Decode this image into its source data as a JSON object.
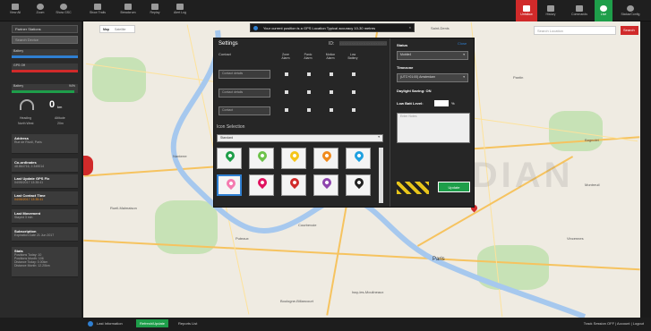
{
  "toolbar": {
    "items": [
      {
        "label": "View All",
        "icon": "layers-icon"
      },
      {
        "label": "Zoom",
        "icon": "globe-icon"
      },
      {
        "label": "Show GSC",
        "icon": "globe-icon"
      },
      {
        "label": "Show Trails",
        "icon": "trail-icon"
      },
      {
        "label": "Breadcrum",
        "icon": "warning-icon"
      },
      {
        "label": "Replay",
        "icon": "plus-icon"
      },
      {
        "label": "Alert Log",
        "icon": "card-icon"
      }
    ],
    "right_items": [
      {
        "label": "Unfollow",
        "icon": "share-icon"
      },
      {
        "label": "History",
        "icon": "image-icon"
      },
      {
        "label": "Commands",
        "icon": "send-icon"
      },
      {
        "label": "Live",
        "icon": "power-icon"
      },
      {
        "label": "Status/Config",
        "icon": "gear-icon"
      }
    ]
  },
  "sidebar": {
    "device_btn": "Partner Stations",
    "search_placeholder": "Search Device",
    "bars": [
      {
        "label": "Battery",
        "color": "#2f7fd1",
        "fraction": 1.0
      },
      {
        "label": "GPS Off",
        "color": "#d02a2a",
        "fraction": 1.0
      },
      {
        "label": "Battery",
        "value": "94%",
        "color": "#1e9e4a",
        "fraction": 0.94
      }
    ],
    "speed": "0",
    "speed_unit": "km",
    "heading_label": "Heading",
    "heading_value": "North West",
    "altitude_label": "Altitude",
    "altitude_value": "20m",
    "cards": [
      {
        "title": "Address",
        "value": "Rue de Rivoli, Paris"
      },
      {
        "title": "Co-ordinates",
        "value": "48.864716, 2.349014"
      },
      {
        "title": "Last Update GPS Fix",
        "value": "04/05/2017 13:35:41"
      },
      {
        "title": "Last Contact Time",
        "value": "04/05/2017 13:35:41"
      },
      {
        "title": "Last Movement",
        "value": "Stayed 3 min"
      },
      {
        "title": "Subscription",
        "value": "Expiration Date 21 Jun 2017"
      }
    ],
    "stats_title": "Stats",
    "stats": [
      "Positions Today: 10",
      "Positions Month: 106",
      "Distance Today: 0.00km",
      "Distance Month: 12.20km"
    ]
  },
  "map": {
    "tab_map": "Map",
    "tab_satellite": "Satellite",
    "search_placeholder": "Search Location",
    "search_button": "Search",
    "towns": [
      "Nanterre",
      "Rueil-Malmaison",
      "Paris",
      "Saint-Denis",
      "Montreuil",
      "Vincennes",
      "Boulogne-Billancourt",
      "Issy-les-Moulineaux",
      "Puteaux",
      "Courbevoie",
      "Bagnolet",
      "Pantin"
    ],
    "watermark": "GUARDIAN"
  },
  "banner": "Your current position is a GPS Location Typical accuracy 10-30 metres",
  "dialog": {
    "title": "Settings",
    "id_label": "ID:",
    "id_value": "XXXXXXXXXXXXXXXXXXXX",
    "contact_label": "Contact",
    "col_headers": [
      "Zone Alarm",
      "Panic Alarm",
      "Motion Alarm",
      "Low Battery"
    ],
    "rows": [
      {
        "placeholder": "Contact details"
      },
      {
        "placeholder": "Contact details"
      },
      {
        "placeholder": "Contact"
      }
    ],
    "icon_selection_label": "Icon Selection",
    "icon_dropdown": "Standard",
    "icon_colors": [
      "#1e9e4a",
      "#6cc24a",
      "#f5c518",
      "#f08a1c",
      "#1ea0e0",
      "#f47ab0",
      "#e0115f",
      "#d02a2a",
      "#8e44ad",
      "#222222"
    ],
    "status_label": "Status",
    "status_value": "Mobile4",
    "timezone_label": "Timezone",
    "timezone_value": "(UTC+01:00) Amsterdam",
    "daylight_label": "Daylight Saving:",
    "daylight_value": "ON",
    "lowbatt_label": "Low Batt Level:",
    "lowbatt_unit": "%",
    "notes_placeholder": "Enter Notes",
    "update_button": "Update",
    "close_label": "Close"
  },
  "bottom": {
    "left_items": [
      "Last Information",
      "Refresh/Update",
      "Reports List"
    ],
    "right_text": "Track Session OFF | Account | Logout"
  }
}
